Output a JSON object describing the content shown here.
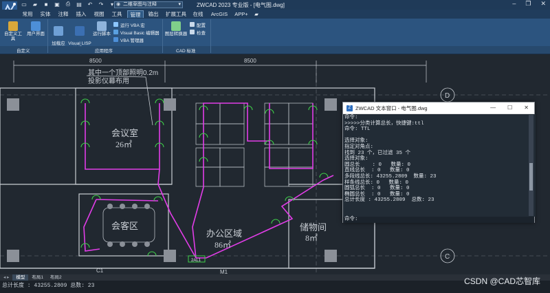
{
  "titlebar": {
    "workspace": "二维草图与注释",
    "title": "ZWCAD 2023 专业版 - [电气图.dwg]",
    "controls": [
      "–",
      "❐",
      "✕"
    ]
  },
  "ribbon_tabs": [
    {
      "label": "常用"
    },
    {
      "label": "实体"
    },
    {
      "label": "注释"
    },
    {
      "label": "插入"
    },
    {
      "label": "视图"
    },
    {
      "label": "工具"
    },
    {
      "label": "管理"
    },
    {
      "label": "输出"
    },
    {
      "label": "扩展工具"
    },
    {
      "label": "在线"
    },
    {
      "label": "ArcGIS"
    },
    {
      "label": "APP+"
    }
  ],
  "ribbon": {
    "custom_tools": "自定义工具",
    "user_interface": "用户界面",
    "load_app": "加载应\n用程序",
    "visual_lisp": "Visual LISP\n编辑器",
    "run_script": "运行脚本",
    "run_vba": "运行 VBA 宏",
    "vba_editor": "Visual Basic 编辑器",
    "vba_manager": "VBA 管理器",
    "layer_converter": "图层转换器",
    "config": "配置",
    "check": "检查",
    "groups": [
      "自定义",
      "应用程序",
      "CAD 标准"
    ]
  },
  "drawing": {
    "dim_left": "8500",
    "dim_right": "8500",
    "annotation_line1": "其中一个顶部照明0.2m",
    "annotation_line2": "投影仪幕布用",
    "room_meeting": "会议室",
    "room_meeting_area": "26㎡",
    "room_reception": "会客区",
    "room_office": "办公区域",
    "room_office_area": "86㎡",
    "room_storage": "储物间",
    "room_storage_area": "8㎡",
    "grid_d": "D",
    "grid_c": "C",
    "panel_label": "2AL1",
    "label_m1": "M1",
    "label_c1": "C1"
  },
  "text_window": {
    "title": "ZWCAD 文本窗口 - 电气图.dwg",
    "lines": [
      "命令:",
      ">>>>>分类计算总长，快捷键:ttl",
      "命令: TTL",
      "",
      "选择对象:",
      "指定对角点:",
      "找到 23 个，已过滤 35 个",
      "选择对象:",
      "圆总长    : 0   数量: 0",
      "直线总长  : 0   数量: 0",
      "多段线总长: 43255.2809  数量: 23",
      "样条线总长: 0   数量: 0",
      "圆弧总长  : 0   数量: 0",
      "椭圆总长  : 0   数量: 0",
      "总计长度 : 43255.2809  总数: 23"
    ],
    "prompt": "命令:"
  },
  "layout_tabs": [
    "模型",
    "布局1",
    "布局2"
  ],
  "status_text": "总计长度 : 43255.2809  总数: 23",
  "watermark": "CSDN @CAD芯智库",
  "colors": {
    "wire": "#e23de8",
    "fixture": "#3fd14a",
    "wall": "#c9ced4",
    "grid": "#7a8088"
  }
}
